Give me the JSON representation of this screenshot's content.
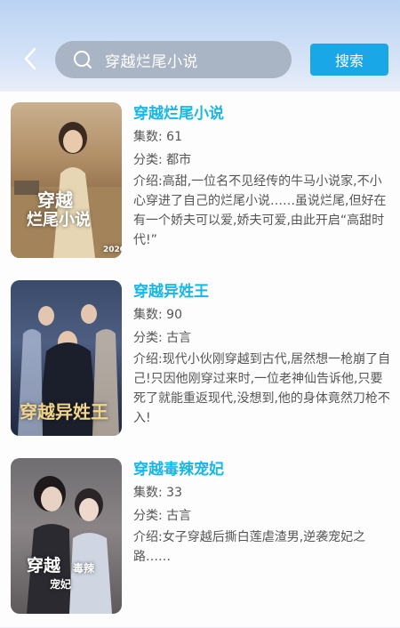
{
  "header": {
    "search_value": "穿越烂尾小说",
    "search_button": "搜索"
  },
  "books": [
    {
      "title": "穿越烂尾小说",
      "count_label": "集数:",
      "count": "61",
      "category_label": "分类:",
      "category": "都市",
      "intro_label": "介绍:",
      "intro": "高甜,一位名不见经传的牛马小说家,不小心穿进了自己的烂尾小说……虽说烂尾,但好在有一个娇夫可以爱,娇夫可爱,由此开启“高甜时代!”",
      "cover_text_1": "穿越",
      "cover_text_2": "烂尾小说",
      "cover_year": "2020"
    },
    {
      "title": "穿越异姓王",
      "count_label": "集数:",
      "count": "90",
      "category_label": "分类:",
      "category": "古言",
      "intro_label": "介绍:",
      "intro": "现代小伙刚穿越到古代,居然想一枪崩了自己!只因他刚穿过来时,一位老神仙告诉他,只要死了就能重返现代,没想到,他的身体竟然刀枪不入!",
      "cover_text_1": "穿越异姓王"
    },
    {
      "title": "穿越毒辣宠妃",
      "count_label": "集数:",
      "count": "33",
      "category_label": "分类:",
      "category": "古言",
      "intro_label": "介绍:",
      "intro": "女子穿越后撕白莲虐渣男,逆袭宠妃之路……",
      "cover_text_1": "穿越",
      "cover_text_2": "毒辣",
      "cover_text_3": "宠妃"
    }
  ]
}
